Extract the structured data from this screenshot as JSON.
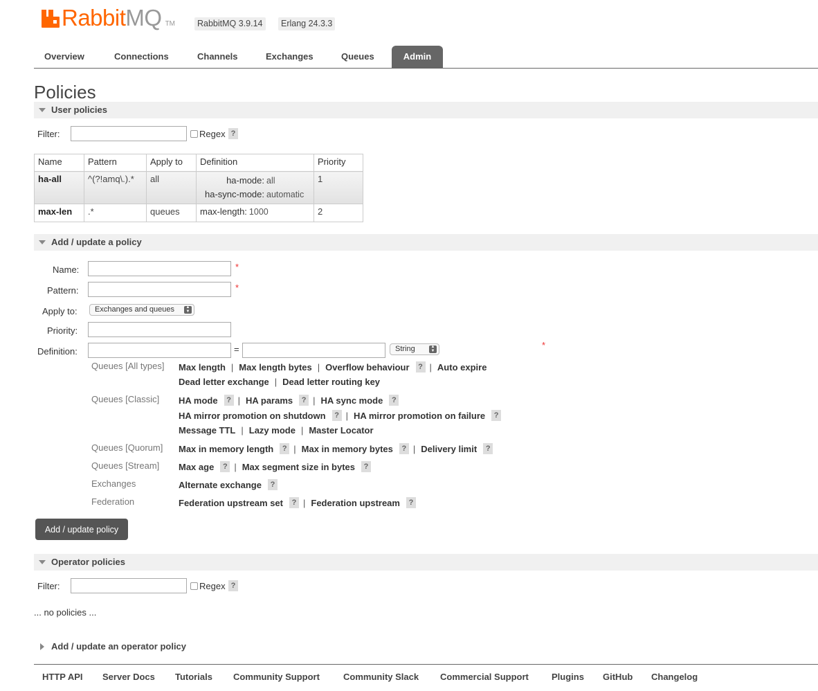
{
  "header": {
    "logo_part1": "Rabbit",
    "logo_part2": "MQ",
    "logo_tm": "TM",
    "version_badge": "RabbitMQ 3.9.14",
    "erlang_badge": "Erlang 24.3.3"
  },
  "tabs": [
    {
      "label": "Overview"
    },
    {
      "label": "Connections"
    },
    {
      "label": "Channels"
    },
    {
      "label": "Exchanges"
    },
    {
      "label": "Queues"
    },
    {
      "label": "Admin",
      "active": true
    }
  ],
  "page_title": "Policies",
  "user_policies": {
    "section_label": "User policies",
    "filter_label": "Filter:",
    "filter_value": "",
    "regex_label": "Regex",
    "help": "?",
    "table": {
      "headers": [
        "Name",
        "Pattern",
        "Apply to",
        "Definition",
        "Priority"
      ],
      "rows": [
        {
          "name": "ha-all",
          "pattern": "^(?!amq\\.).*",
          "apply_to": "all",
          "definition": [
            {
              "key": "ha-mode:",
              "value": "all"
            },
            {
              "key": "ha-sync-mode:",
              "value": "automatic"
            }
          ],
          "priority": "1"
        },
        {
          "name": "max-len",
          "pattern": ".*",
          "apply_to": "queues",
          "definition": [
            {
              "key": "max-length:",
              "value": "1000"
            }
          ],
          "priority": "2"
        }
      ]
    }
  },
  "add_policy": {
    "section_label": "Add / update a policy",
    "name_label": "Name:",
    "pattern_label": "Pattern:",
    "apply_to_label": "Apply to:",
    "apply_to_value": "Exchanges and queues",
    "priority_label": "Priority:",
    "definition_label": "Definition:",
    "equals": "=",
    "type_value": "String",
    "required_mark": "*",
    "categories": [
      {
        "label": "Queues [All types]"
      },
      {
        "label": "Queues [Classic]"
      },
      {
        "label": "Queues [Quorum]"
      },
      {
        "label": "Queues [Stream]"
      },
      {
        "label": "Exchanges"
      },
      {
        "label": "Federation"
      }
    ],
    "keys": {
      "max_length": "Max length",
      "max_length_bytes": "Max length bytes",
      "overflow_behaviour": "Overflow behaviour",
      "auto_expire": "Auto expire",
      "dead_letter_exchange": "Dead letter exchange",
      "dead_letter_routing_key": "Dead letter routing key",
      "ha_mode": "HA mode",
      "ha_params": "HA params",
      "ha_sync_mode": "HA sync mode",
      "ha_promo_shutdown": "HA mirror promotion on shutdown",
      "ha_promo_failure": "HA mirror promotion on failure",
      "message_ttl": "Message TTL",
      "lazy_mode": "Lazy mode",
      "master_locator": "Master Locator",
      "max_in_memory_length": "Max in memory length",
      "max_in_memory_bytes": "Max in memory bytes",
      "delivery_limit": "Delivery limit",
      "max_age": "Max age",
      "max_segment_size": "Max segment size in bytes",
      "alternate_exchange": "Alternate exchange",
      "federation_upstream_set": "Federation upstream set",
      "federation_upstream": "Federation upstream"
    },
    "separator": "|",
    "submit_label": "Add / update policy"
  },
  "operator_policies": {
    "section_label": "Operator policies",
    "filter_label": "Filter:",
    "regex_label": "Regex",
    "empty_text": "... no policies ..."
  },
  "add_operator_policy": {
    "section_label": "Add / update an operator policy"
  },
  "footer": [
    {
      "label": "HTTP API"
    },
    {
      "label": "Server Docs"
    },
    {
      "label": "Tutorials"
    },
    {
      "label": "Community Support"
    },
    {
      "label": "Community Slack"
    },
    {
      "label": "Commercial Support"
    },
    {
      "label": "Plugins"
    },
    {
      "label": "GitHub"
    },
    {
      "label": "Changelog"
    }
  ]
}
